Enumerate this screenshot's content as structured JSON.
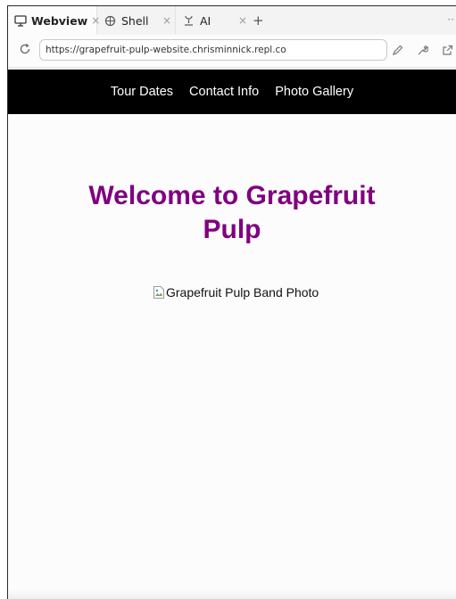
{
  "tabs": [
    {
      "label": "Webview",
      "icon": "monitor-icon",
      "close": "×"
    },
    {
      "label": "Shell",
      "icon": "shell-icon",
      "close": "×"
    },
    {
      "label": "AI",
      "icon": "ai-icon",
      "close": "×"
    }
  ],
  "new_tab": "+",
  "overflow": "··",
  "address": {
    "url": "https://grapefruit-pulp-website.chrisminnick.repl.co"
  },
  "site": {
    "nav": [
      "Tour Dates",
      "Contact Info",
      "Photo Gallery"
    ],
    "heading_line1": "Welcome to Grapefruit",
    "heading_line2": "Pulp",
    "photo_alt": "Grapefruit Pulp Band Photo"
  },
  "colors": {
    "heading": "#800080",
    "nav_bg": "#000000",
    "nav_text": "#ffffff"
  }
}
